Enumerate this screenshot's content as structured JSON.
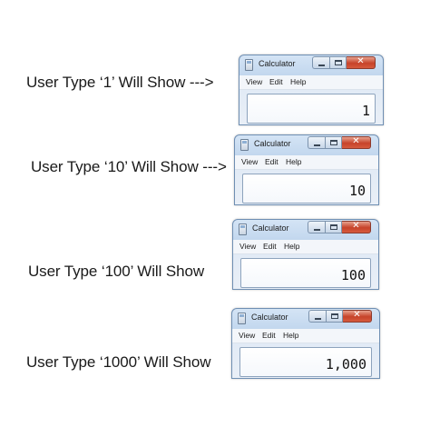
{
  "rows": [
    {
      "caption": "User Type ‘1’ Will Show --->",
      "window_title": "Calculator",
      "menu": [
        "View",
        "Edit",
        "Help"
      ],
      "display": "1",
      "close_glyph": "✕"
    },
    {
      "caption": "User Type ‘10’ Will Show --->",
      "window_title": "Calculator",
      "menu": [
        "View",
        "Edit",
        "Help"
      ],
      "display": "10",
      "close_glyph": "✕"
    },
    {
      "caption": "User Type ‘100’ Will Show",
      "window_title": "Calculator",
      "menu": [
        "View",
        "Edit",
        "Help"
      ],
      "display": "100",
      "close_glyph": "✕"
    },
    {
      "caption": "User Type ‘1000’ Will Show",
      "window_title": "Calculator",
      "menu": [
        "View",
        "Edit",
        "Help"
      ],
      "display": "1,000",
      "close_glyph": "✕"
    }
  ],
  "icons": {
    "app": "calculator-icon",
    "minimize": "minimize-icon",
    "maximize": "maximize-icon",
    "close": "close-icon"
  },
  "colors": {
    "window_border": "#6f8fb3",
    "titlebar": "#c2d7ee",
    "close_button": "#c7432a",
    "display_border": "#8da3bd"
  }
}
